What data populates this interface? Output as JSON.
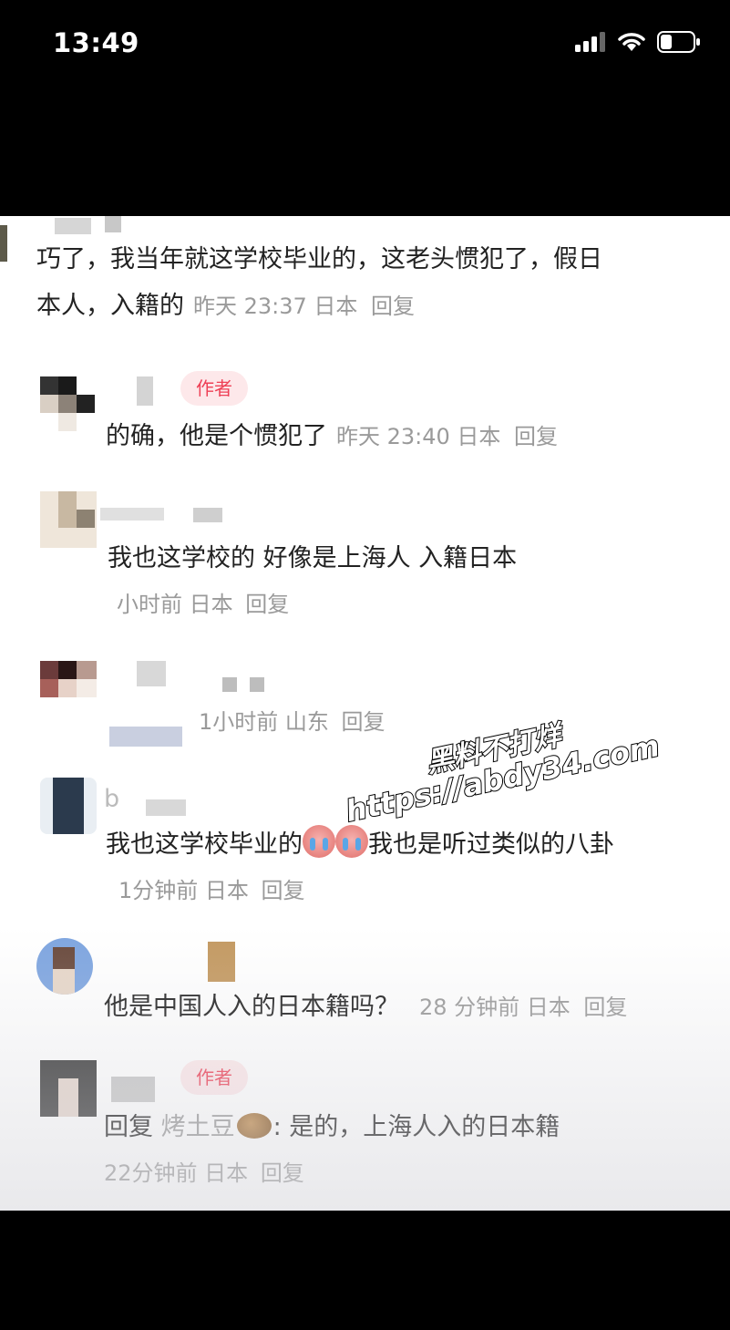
{
  "status": {
    "time": "13:49"
  },
  "comments": [
    {
      "text": "巧了，我当年就这学校毕业的，这老头惯犯了，假日",
      "text2": "本人，入籍的",
      "meta": "昨天 23:37 日本",
      "reply": "回复"
    },
    {
      "badge": "作者",
      "text": "的确，他是个惯犯了",
      "meta": "昨天 23:40 日本",
      "reply": "回复"
    },
    {
      "text": "我也这学校的 好像是上海人 入籍日本",
      "meta": "小时前 日本",
      "reply": "回复"
    },
    {
      "meta": "1小时前 山东",
      "reply": "回复"
    },
    {
      "name": "b",
      "text": "我也这学校毕业的",
      "text2": "我也是听过类似的八卦",
      "meta": "1分钟前 日本",
      "reply": "回复"
    },
    {
      "text": "他是中国人入的日本籍吗？",
      "meta": "28 分钟前 日本",
      "reply": "回复"
    },
    {
      "badge": "作者",
      "reply_prefix": "回复",
      "quote_name": "烤土豆",
      "text": ": 是的，上海人入的日本籍",
      "meta": "22分钟前 日本",
      "reply": "回复"
    }
  ],
  "watermark": {
    "line1": "黑料不打烊",
    "line2": "https://abdy34.com"
  },
  "colors": {
    "author_badge": "#ee4056",
    "meta_text": "#9a9a9a"
  }
}
